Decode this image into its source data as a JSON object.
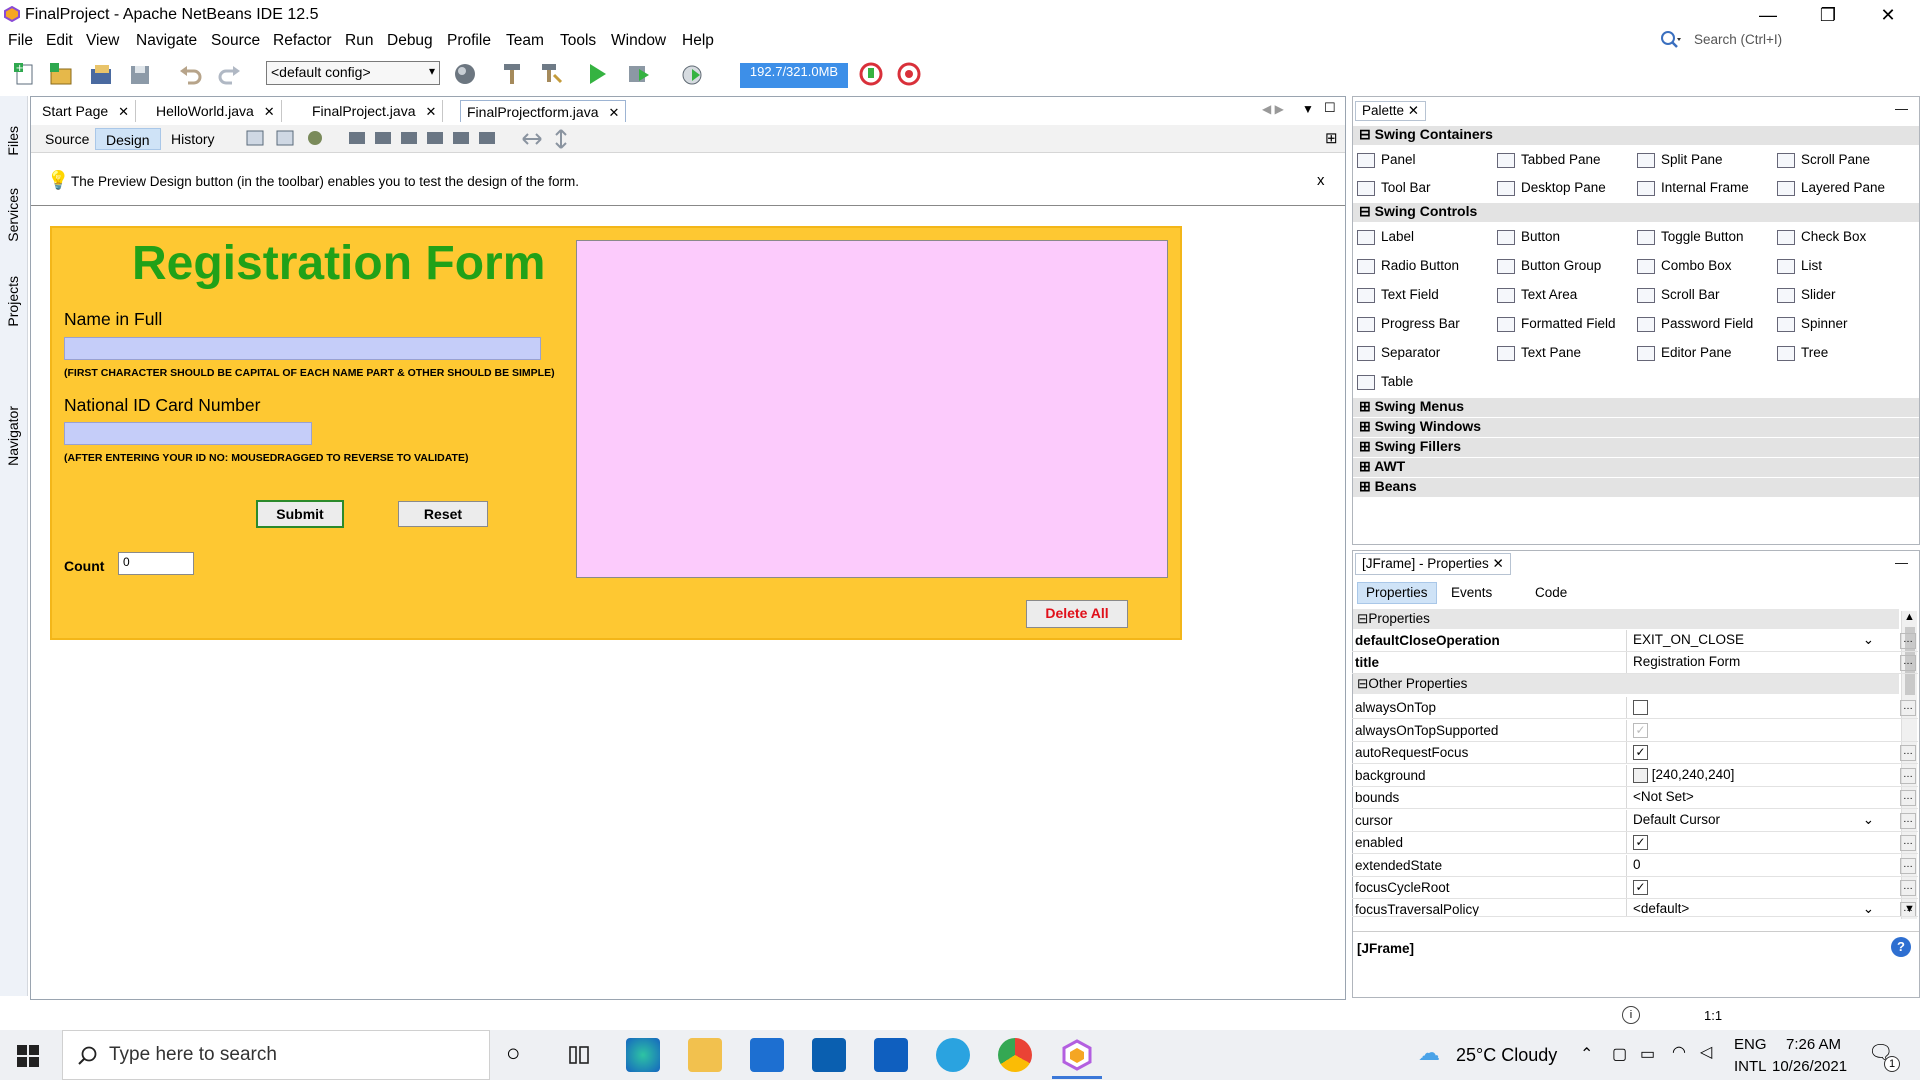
{
  "window": {
    "title": "FinalProject - Apache NetBeans IDE 12.5",
    "minimize": "—",
    "restore": "❐",
    "close": "✕"
  },
  "menu": [
    "File",
    "Edit",
    "View",
    "Navigate",
    "Source",
    "Refactor",
    "Run",
    "Debug",
    "Profile",
    "Team",
    "Tools",
    "Window",
    "Help"
  ],
  "search": {
    "placeholder": "Search (Ctrl+I)"
  },
  "toolbar": {
    "config": "<default config>",
    "memory": "192.7/321.0MB"
  },
  "side_tabs": [
    "Files",
    "Services",
    "Projects",
    "Navigator"
  ],
  "file_tabs": [
    {
      "label": "Start Page"
    },
    {
      "label": "HelloWorld.java"
    },
    {
      "label": "FinalProject.java"
    },
    {
      "label": "FinalProjectform.java",
      "active": true
    }
  ],
  "sub_tabs": [
    "Source",
    "Design",
    "History"
  ],
  "hint": {
    "text": "The Preview Design button (in the toolbar) enables you to test the design of the form.",
    "close": "x"
  },
  "form": {
    "title": "Registration Form",
    "name_label": "Name in Full",
    "name_note": "(FIRST CHARACTER SHOULD BE CAPITAL OF EACH NAME PART & OTHER SHOULD BE SIMPLE)",
    "nic_label": "National ID Card Number",
    "nic_note": "(AFTER ENTERING YOUR ID NO: MOUSEDRAGGED TO REVERSE TO VALIDATE)",
    "submit": "Submit",
    "reset": "Reset",
    "count_label": "Count",
    "count_value": "0",
    "delete_all": "Delete All",
    "colors": {
      "background": "#fec832",
      "title": "#21a118",
      "field": "#c5cdf9",
      "text_area": "#fccbfc",
      "delete_text": "#e0101a"
    }
  },
  "palette": {
    "title": "Palette",
    "sections": [
      {
        "name": "Swing Containers",
        "expanded": true,
        "items": [
          "Panel",
          "Tabbed Pane",
          "Split Pane",
          "Scroll Pane",
          "Tool Bar",
          "Desktop Pane",
          "Internal Frame",
          "Layered Pane"
        ]
      },
      {
        "name": "Swing Controls",
        "expanded": true,
        "items": [
          "Label",
          "Button",
          "Toggle Button",
          "Check Box",
          "Radio Button",
          "Button Group",
          "Combo Box",
          "List",
          "Text Field",
          "Text Area",
          "Scroll Bar",
          "Slider",
          "Progress Bar",
          "Formatted Field",
          "Password Field",
          "Spinner",
          "Separator",
          "Text Pane",
          "Editor Pane",
          "Tree",
          "Table"
        ]
      },
      {
        "name": "Swing Menus",
        "expanded": false
      },
      {
        "name": "Swing Windows",
        "expanded": false
      },
      {
        "name": "Swing Fillers",
        "expanded": false
      },
      {
        "name": "AWT",
        "expanded": false
      },
      {
        "name": "Beans",
        "expanded": false
      }
    ]
  },
  "properties": {
    "title": "[JFrame] - Properties",
    "tabs": [
      "Properties",
      "Events",
      "Code"
    ],
    "group1": "Properties",
    "group2": "Other Properties",
    "rows": [
      {
        "key": "defaultCloseOperation",
        "value": "EXIT_ON_CLOSE",
        "bold": true,
        "combo": true
      },
      {
        "key": "title",
        "value": "Registration Form",
        "bold": true
      },
      {
        "key": "alwaysOnTop",
        "check": false
      },
      {
        "key": "alwaysOnTopSupported",
        "check": true,
        "disabled": true
      },
      {
        "key": "autoRequestFocus",
        "check": true
      },
      {
        "key": "background",
        "value": "[240,240,240]",
        "swatch": true
      },
      {
        "key": "bounds",
        "value": "<Not Set>"
      },
      {
        "key": "cursor",
        "value": "Default Cursor",
        "combo": true
      },
      {
        "key": "enabled",
        "check": true
      },
      {
        "key": "extendedState",
        "value": "0"
      },
      {
        "key": "focusCycleRoot",
        "check": true
      },
      {
        "key": "focusTraversalPolicy",
        "value": "<default>",
        "combo": true
      }
    ],
    "footer": "[JFrame]"
  },
  "status": {
    "zoom": "1:1"
  },
  "taskbar": {
    "search": "Type here to search",
    "weather": "25°C  Cloudy",
    "lang1": "ENG",
    "lang2": "INTL",
    "time": "7:26 AM",
    "date": "10/26/2021",
    "notif": "1"
  }
}
